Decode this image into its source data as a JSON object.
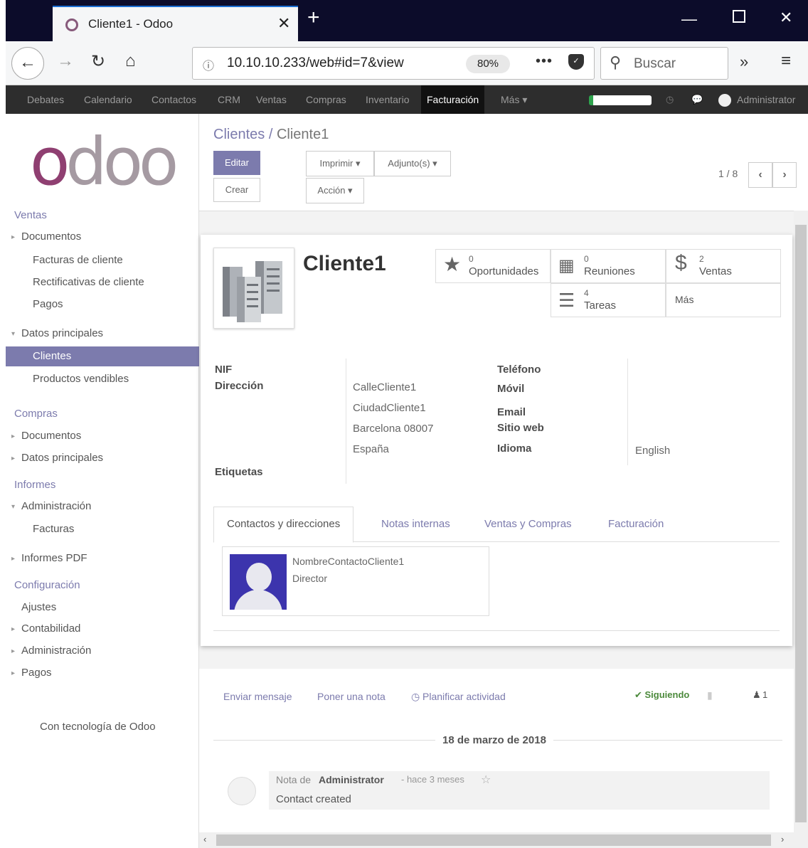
{
  "browser": {
    "tab_title": "Cliente1 - Odoo",
    "url": "10.10.10.233/web#id=7&view",
    "zoom": "80%",
    "search_placeholder": "Buscar"
  },
  "odoo_menu": {
    "items": [
      "Debates",
      "Calendario",
      "Contactos",
      "CRM",
      "Ventas",
      "Compras",
      "Inventario",
      "Facturación",
      "Más ▾"
    ],
    "active": "Facturación",
    "user": "Administrator"
  },
  "sidebar": {
    "sections": [
      {
        "title": "Ventas"
      },
      {
        "title": "Compras"
      },
      {
        "title": "Informes"
      },
      {
        "title": "Configuración"
      }
    ],
    "items": {
      "documentos": "Documentos",
      "facturas_cliente": "Facturas de cliente",
      "rectificativas": "Rectificativas de cliente",
      "pagos": "Pagos",
      "datos_principales": "Datos principales",
      "clientes": "Clientes",
      "productos_vendibles": "Productos vendibles",
      "compras_documentos": "Documentos",
      "compras_datos": "Datos principales",
      "administracion": "Administración",
      "facturas": "Facturas",
      "informes_pdf": "Informes PDF",
      "ajustes": "Ajustes",
      "contabilidad": "Contabilidad",
      "config_administracion": "Administración",
      "config_pagos": "Pagos"
    },
    "powered": "Con tecnología de Odoo"
  },
  "control_panel": {
    "breadcrumb_root": "Clientes",
    "breadcrumb_sep": "/",
    "breadcrumb_current": "Cliente1",
    "edit": "Editar",
    "create": "Crear",
    "print": "Imprimir ▾",
    "attachments": "Adjunto(s) ▾",
    "action": "Acción ▾",
    "pager": "1 / 8"
  },
  "record": {
    "name": "Cliente1",
    "smart_buttons": {
      "oportunidades": {
        "count": "0",
        "label": "Oportunidades"
      },
      "reuniones": {
        "count": "0",
        "label": "Reuniones"
      },
      "ventas": {
        "count": "2",
        "label": "Ventas"
      },
      "tareas": {
        "count": "4",
        "label": "Tareas"
      },
      "mas": "Más"
    },
    "labels": {
      "nif": "NIF",
      "direccion": "Dirección",
      "etiquetas": "Etiquetas",
      "telefono": "Teléfono",
      "movil": "Móvil",
      "email": "Email",
      "sitio_web": "Sitio web",
      "idioma": "Idioma"
    },
    "address": [
      "CalleCliente1",
      "CiudadCliente1",
      "Barcelona 08007",
      "España"
    ],
    "language": "English",
    "tabs": [
      "Contactos y direcciones",
      "Notas internas",
      "Ventas y Compras",
      "Facturación"
    ],
    "contact": {
      "name": "NombreContactoCliente1",
      "role": "Director"
    }
  },
  "chatter": {
    "send_message": "Enviar mensaje",
    "log_note": "Poner una nota",
    "schedule": "Planificar actividad",
    "following": "✔ Siguiendo",
    "followers": "1",
    "date": "18 de marzo de 2018",
    "msg_prefix": "Nota de",
    "msg_author": "Administrator",
    "msg_time": "- hace 3 meses",
    "msg_body": "Contact created"
  }
}
